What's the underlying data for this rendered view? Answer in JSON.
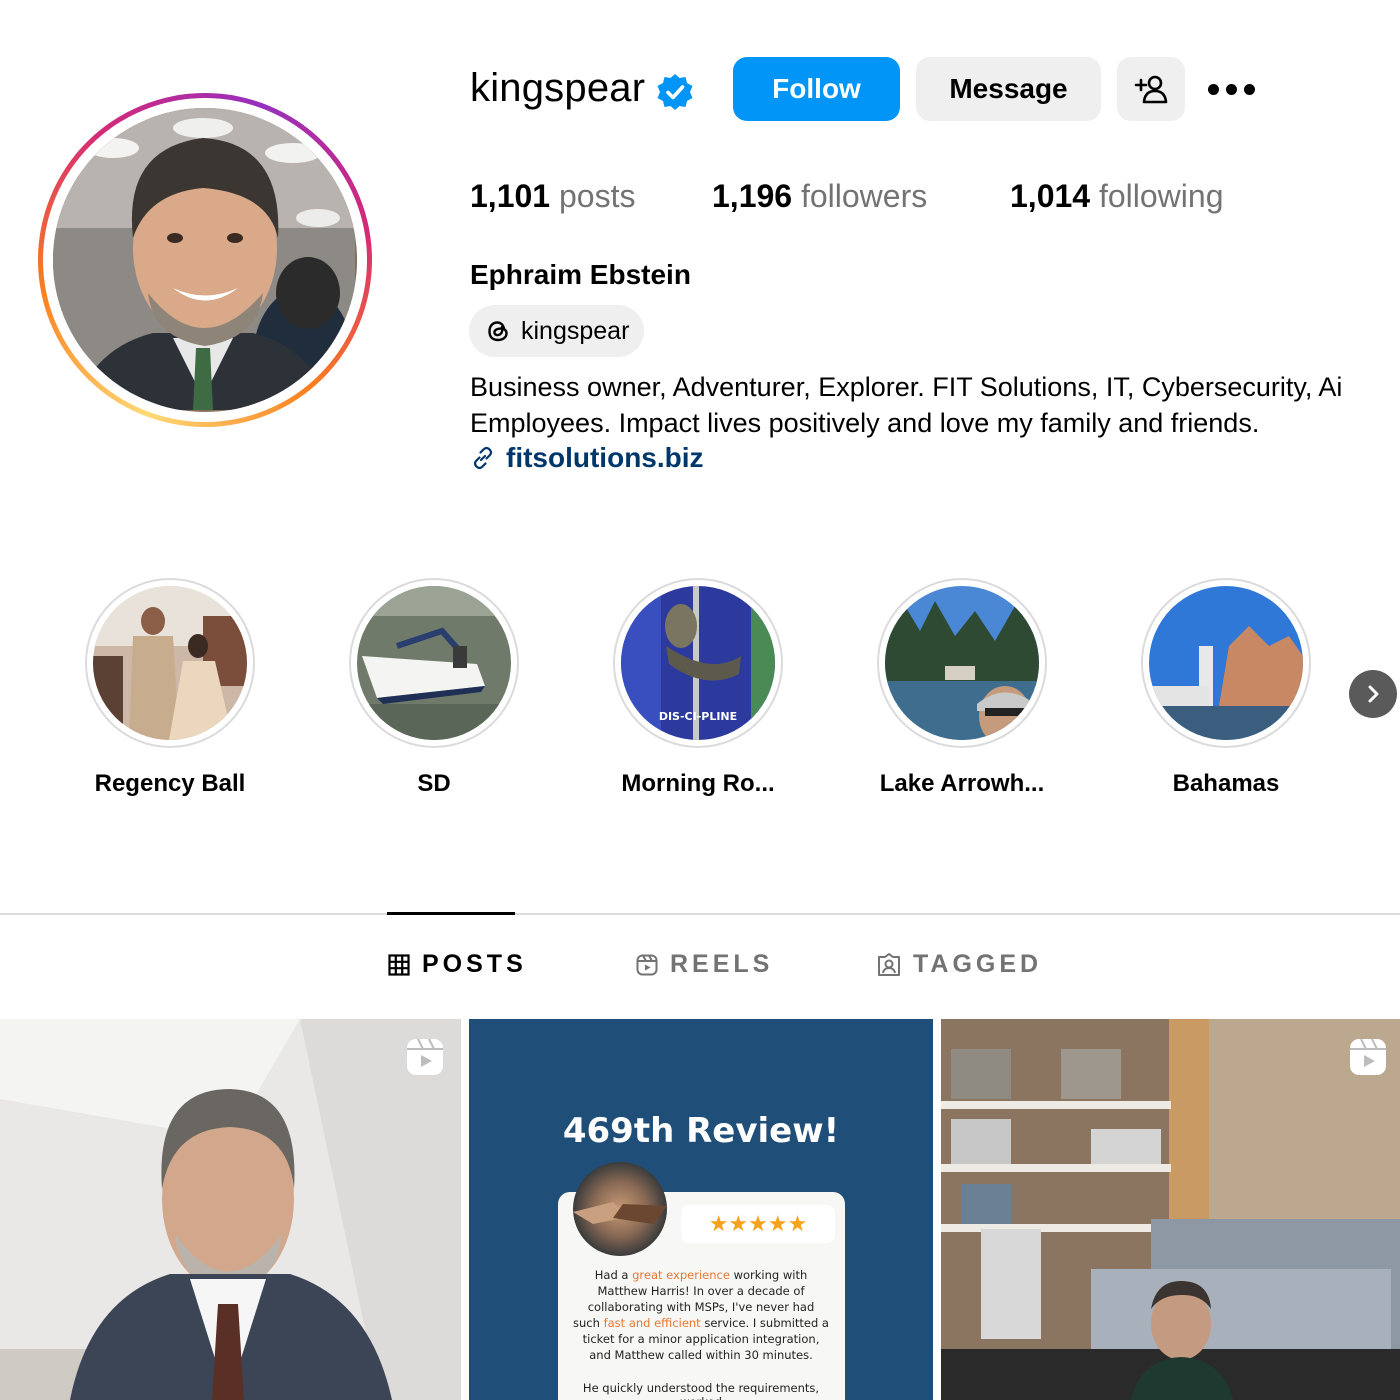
{
  "profile": {
    "username": "kingspear",
    "verified": true,
    "full_name": "Ephraim Ebstein",
    "threads_handle": "kingspear",
    "bio_line1": "Business owner, Adventurer, Explorer. FIT Solutions, IT, Cybersecurity, Ai",
    "bio_line2": "Employees. Impact lives positively and love my family and friends.",
    "link": "fitsolutions.biz"
  },
  "actions": {
    "follow_label": "Follow",
    "message_label": "Message",
    "add_user_icon": "add-user-icon",
    "more_icon": "more-horizontal-icon"
  },
  "stats": {
    "posts_count": "1,101",
    "posts_label": "posts",
    "followers_count": "1,196",
    "followers_label": "followers",
    "following_count": "1,014",
    "following_label": "following"
  },
  "highlights": [
    {
      "label": "Regency Ball"
    },
    {
      "label": "SD"
    },
    {
      "label": "Morning Ro...",
      "overlay_text": "DIS-CI-PLINE"
    },
    {
      "label": "Lake Arrowh..."
    },
    {
      "label": "Bahamas"
    }
  ],
  "tabs": [
    {
      "label": "POSTS",
      "icon": "grid-icon",
      "active": true
    },
    {
      "label": "REELS",
      "icon": "reels-icon",
      "active": false
    },
    {
      "label": "TAGGED",
      "icon": "tagged-icon",
      "active": false
    }
  ],
  "posts": [
    {
      "type": "reel"
    },
    {
      "type": "image",
      "title": "469th Review!",
      "rating": "★★★★★",
      "review_line1_pre": "Had a ",
      "review_line1_hl": "great experience",
      "review_line1_post": " working with Matthew Harris! In over a decade of collaborating with MSPs, I've never had such ",
      "review_line2_hl": "fast and efficient",
      "review_line2_post": " service. I submitted a ticket for a minor application integration, and Matthew called within 30 minutes.",
      "review_line3": "He quickly understood the requirements, worked"
    },
    {
      "type": "reel"
    }
  ],
  "colors": {
    "follow_blue": "#0095f6",
    "link_blue": "#00376b",
    "secondary_text": "#737373",
    "button_gray": "#efefef",
    "review_bg": "#1f4e79",
    "star_orange": "#f7a21b"
  }
}
